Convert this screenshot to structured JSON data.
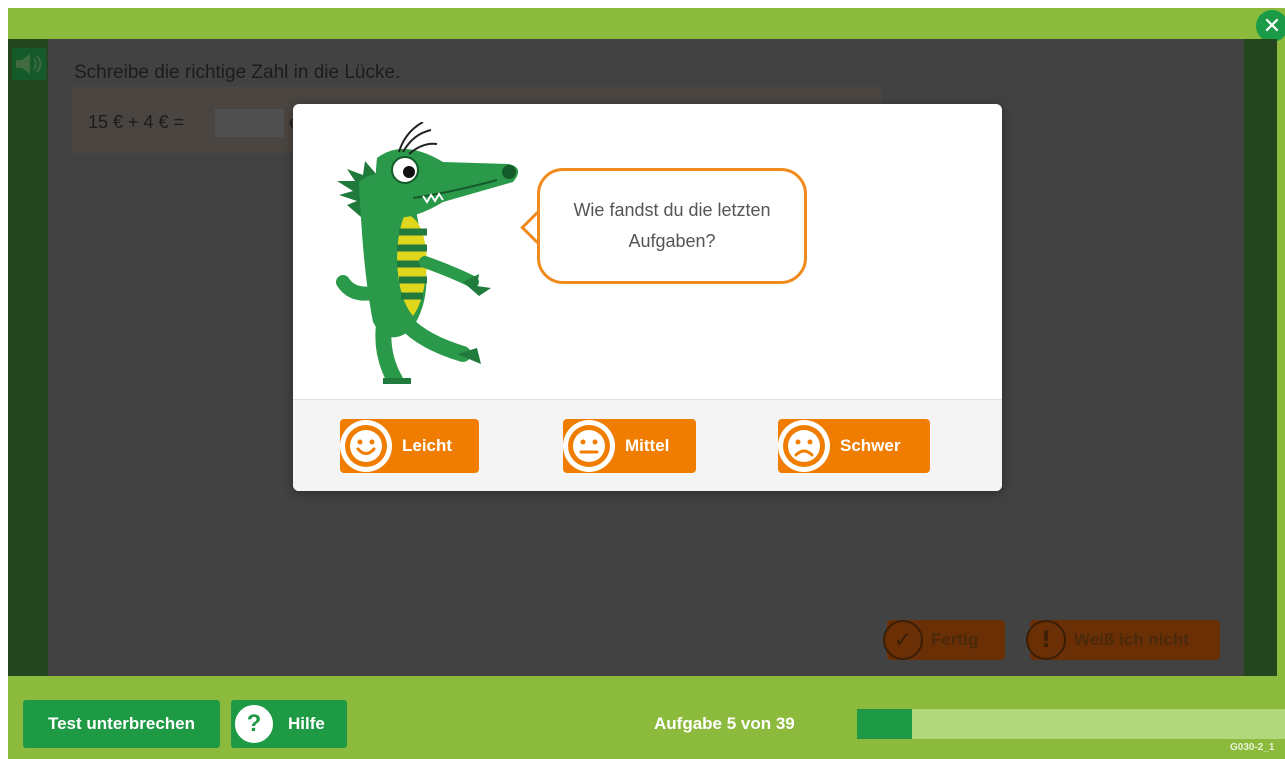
{
  "header": {
    "close_icon": "close-icon"
  },
  "task": {
    "instruction": "Schreibe die richtige Zahl in die Lücke.",
    "equation": "15 € + 4 € =",
    "answer_value": "",
    "cut_text": "€"
  },
  "actions": {
    "fertig_label": "Fertig",
    "weiss_label": "Weiß ich nicht"
  },
  "dialog": {
    "question": "Wie fandst du die letzten Aufgaben?",
    "options": [
      {
        "label": "Leicht",
        "icon": "happy-face-icon"
      },
      {
        "label": "Mittel",
        "icon": "neutral-face-icon"
      },
      {
        "label": "Schwer",
        "icon": "sad-face-icon"
      }
    ]
  },
  "footer": {
    "test_button": "Test unterbrechen",
    "help_button": "Hilfe",
    "progress_text": "Aufgabe 5 von 39",
    "progress_current": 5,
    "progress_total": 39,
    "code": "G030-2_1"
  },
  "colors": {
    "frame_green": "#8bba3c",
    "button_green": "#1e9a45",
    "accent_orange": "#f07d00",
    "overlay": "#424242"
  }
}
